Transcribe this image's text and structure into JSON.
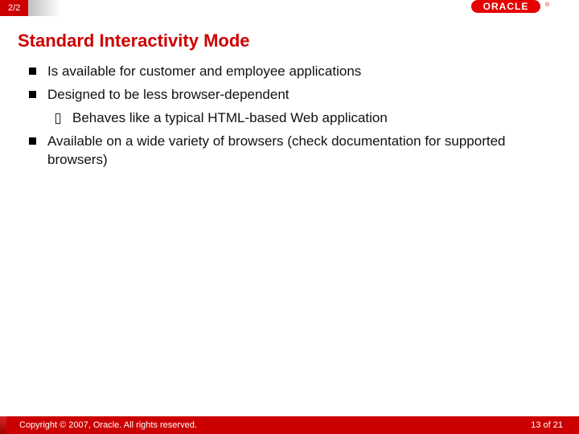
{
  "header": {
    "tab": "2/2",
    "logo_text": "ORACLE"
  },
  "title": "Standard Interactivity Mode",
  "bullets": [
    {
      "level": 1,
      "text": "Is available for customer and employee applications"
    },
    {
      "level": 1,
      "text": "Designed to be less browser-dependent"
    },
    {
      "level": 2,
      "text": "Behaves like a typical HTML-based Web application"
    },
    {
      "level": 1,
      "text": "Available on a wide variety of browsers (check documentation for supported browsers)"
    }
  ],
  "footer": {
    "copyright": "Copyright © 2007, Oracle. All rights reserved.",
    "page": "13 of 21"
  }
}
